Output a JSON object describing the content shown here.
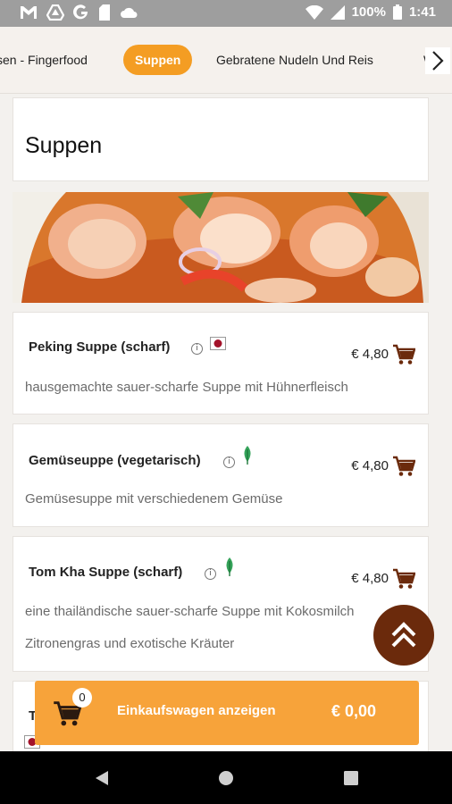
{
  "status_bar": {
    "battery": "100%",
    "time": "1:41"
  },
  "categories": {
    "items": [
      {
        "label": "sen - Fingerfood",
        "active": false
      },
      {
        "label": "Suppen",
        "active": true
      },
      {
        "label": "Gebratene Nudeln Und Reis",
        "active": false
      },
      {
        "label": "W",
        "active": false
      }
    ]
  },
  "section": {
    "title": "Suppen"
  },
  "items": [
    {
      "name": "Peking Suppe (scharf)",
      "description": "hausgemachte sauer-scharfe Suppe mit Hühnerfleisch",
      "price": "€ 4,80",
      "badge": "spicy-icon"
    },
    {
      "name": "Gemüseuppe (vegetarisch)",
      "description": "Gemüsesuppe mit verschiedenem Gemüse",
      "price": "€ 4,80",
      "badge": "vegetarian-leaf-icon"
    },
    {
      "name": "Tom Kha Suppe (scharf)",
      "description_line1": "eine thailändische sauer-scharfe Suppe mit Kokosmilch",
      "description_line2": "Zitronengras und exotische Kräuter",
      "price": "€ 4,80",
      "badge": "vegetarian-leaf-icon"
    },
    {
      "name": "T"
    }
  ],
  "cart": {
    "count": "0",
    "label": "Einkaufswagen anzeigen",
    "total": "€ 0,00"
  },
  "colors": {
    "accent": "#f49d23",
    "brand_brown": "#6b2a0c",
    "cart_icon": "#6b2a0c"
  },
  "icons": [
    "mail-icon",
    "drive-icon",
    "google-icon",
    "clipboard-icon",
    "cloud-icon",
    "wifi-icon",
    "signal-icon",
    "battery-icon",
    "chevron-right-icon",
    "info-icon",
    "cart-icon",
    "double-chevron-up-icon",
    "back-icon",
    "home-icon",
    "recents-icon"
  ]
}
